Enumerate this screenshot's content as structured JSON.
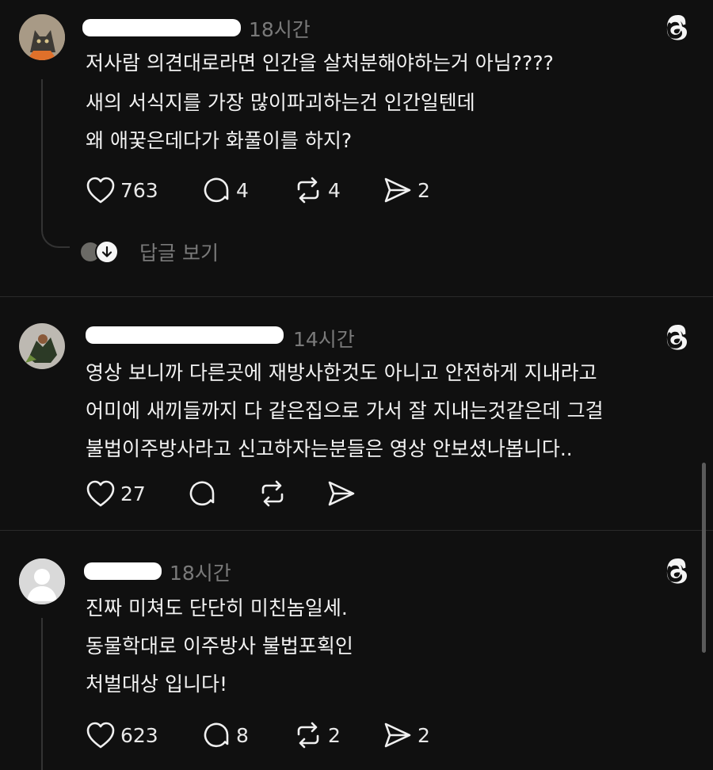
{
  "colors": {
    "background": "#101010",
    "text": "#f3f3f3",
    "muted": "#7a7a7a",
    "divider": "#2a2a2a"
  },
  "comments": [
    {
      "time": "18시간",
      "lines": [
        "저사람 의견대로라면 인간을 살처분해야하는거 아님????",
        "새의 서식지를 가장 많이파괴하는건 인간일텐데",
        "왜 애꿎은데다가 화풀이를 하지?"
      ],
      "likes": "763",
      "replies": "4",
      "reposts": "4",
      "shares": "2",
      "view_replies": "답글 보기"
    },
    {
      "time": "14시간",
      "lines": [
        "영상 보니까 다른곳에 재방사한것도 아니고 안전하게 지내라고",
        "어미에 새끼들까지 다 같은집으로 가서 잘 지내는것같은데 그걸",
        "불법이주방사라고 신고하자는분들은 영상 안보셨나봅니다.."
      ],
      "likes": "27"
    },
    {
      "time": "18시간",
      "lines": [
        "진짜 미쳐도 단단히 미친놈일세.",
        "동물학대로 이주방사 불법포획인",
        "처벌대상 입니다!"
      ],
      "likes": "623",
      "replies": "8",
      "reposts": "2",
      "shares": "2"
    }
  ]
}
